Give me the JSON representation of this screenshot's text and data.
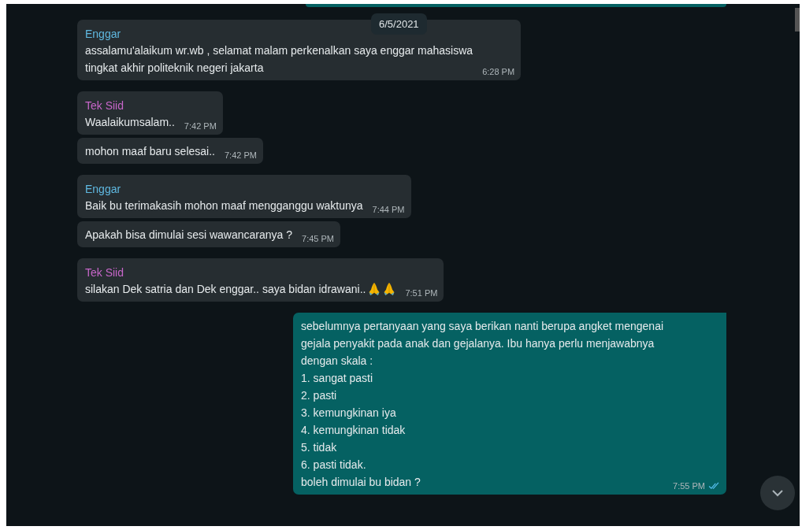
{
  "date_chip": "6/5/2021",
  "groups": [
    {
      "kind": "incoming",
      "sender": "Enggar",
      "color": "#5fb8e0",
      "messages": [
        {
          "lines": [
            "assalamu'alaikum wr.wb , selamat malam perkenalkan saya enggar mahasiswa",
            "tingkat akhir politeknik negeri jakarta"
          ],
          "time": "6:28 PM"
        }
      ]
    },
    {
      "kind": "incoming",
      "sender": "Tek Siid",
      "color": "#c766c9",
      "messages": [
        {
          "lines": [
            "Waalaikumsalam.."
          ],
          "time": "7:42 PM"
        },
        {
          "lines": [
            "mohon maaf baru selesai.."
          ],
          "time": "7:42 PM"
        }
      ]
    },
    {
      "kind": "incoming",
      "sender": "Enggar",
      "color": "#5fb8e0",
      "messages": [
        {
          "lines": [
            "Baik bu terimakasih mohon maaf mengganggu waktunya"
          ],
          "time": "7:44 PM"
        },
        {
          "lines": [
            "Apakah bisa dimulai sesi wawancaranya ?"
          ],
          "time": "7:45 PM"
        }
      ]
    },
    {
      "kind": "incoming",
      "sender": "Tek Siid",
      "color": "#c766c9",
      "messages": [
        {
          "lines": [
            "silakan Dek satria dan Dek enggar.. saya bidan idrawani.."
          ],
          "icons": [
            {
              "kind": "praying-hands"
            },
            {
              "kind": "praying-hands"
            }
          ],
          "time": "7:51 PM"
        }
      ]
    },
    {
      "kind": "outgoing",
      "messages": [
        {
          "lines": [
            "sebelumnya pertanyaan yang saya berikan nanti berupa angket mengenai",
            "gejala penyakit pada anak dan gejalanya.  Ibu hanya perlu menjawabnya",
            "dengan skala :",
            "1. sangat pasti",
            "2. pasti",
            "3. kemungkinan iya",
            "4. kemungkinan tidak",
            "5. tidak",
            "6. pasti tidak.",
            "boleh dimulai bu bidan ?"
          ],
          "time": "7:55 PM",
          "read": true
        }
      ]
    }
  ]
}
